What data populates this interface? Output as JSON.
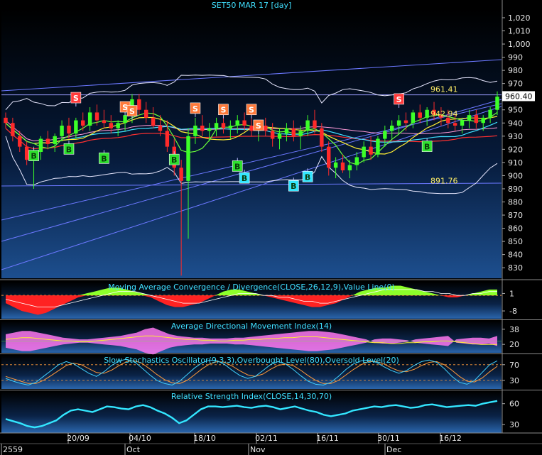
{
  "chart_data": {
    "type": "candlestick",
    "title": "SET50 MAR 17   [day]",
    "symbol": "SET50 MAR 17",
    "period": "[day]",
    "y_ticks": [
      "1,020",
      "1,010",
      "1,000",
      "990",
      "980",
      "970",
      "960",
      "950",
      "940",
      "930",
      "920",
      "910",
      "900",
      "890",
      "880",
      "870",
      "860",
      "850",
      "840",
      "830"
    ],
    "ylim": [
      822,
      1027
    ],
    "last_price": "960.40",
    "annotations": [
      {
        "label": "961.41",
        "value": 961.41
      },
      {
        "label": "942.94",
        "value": 942.94
      },
      {
        "label": "891.76",
        "value": 891.76
      }
    ],
    "x_tick_labels": [
      "20/09",
      "04/10",
      "18/10",
      "02/11",
      "16/11",
      "30/11",
      "16/12"
    ],
    "month_labels": [
      "2559",
      "Oct",
      "Nov",
      "Dec"
    ],
    "candles": [
      [
        944,
        948,
        936,
        940
      ],
      [
        940,
        944,
        926,
        930
      ],
      [
        930,
        934,
        918,
        922
      ],
      [
        922,
        926,
        908,
        912
      ],
      [
        912,
        922,
        890,
        918
      ],
      [
        918,
        930,
        912,
        928
      ],
      [
        928,
        934,
        920,
        924
      ],
      [
        924,
        932,
        918,
        930
      ],
      [
        930,
        942,
        926,
        938
      ],
      [
        938,
        944,
        928,
        932
      ],
      [
        932,
        944,
        928,
        942
      ],
      [
        942,
        948,
        934,
        938
      ],
      [
        938,
        952,
        934,
        948
      ],
      [
        948,
        954,
        938,
        942
      ],
      [
        942,
        950,
        936,
        940
      ],
      [
        940,
        946,
        932,
        936
      ],
      [
        936,
        942,
        930,
        940
      ],
      [
        940,
        948,
        934,
        946
      ],
      [
        946,
        962,
        940,
        958
      ],
      [
        958,
        962,
        946,
        950
      ],
      [
        950,
        956,
        940,
        944
      ],
      [
        944,
        952,
        936,
        938
      ],
      [
        938,
        946,
        930,
        934
      ],
      [
        934,
        942,
        918,
        922
      ],
      [
        922,
        928,
        900,
        906
      ],
      [
        906,
        912,
        824,
        896
      ],
      [
        896,
        936,
        852,
        930
      ],
      [
        930,
        944,
        924,
        938
      ],
      [
        938,
        946,
        930,
        934
      ],
      [
        934,
        940,
        926,
        936
      ],
      [
        936,
        944,
        930,
        940
      ],
      [
        940,
        946,
        932,
        936
      ],
      [
        936,
        942,
        928,
        938
      ],
      [
        938,
        946,
        932,
        942
      ],
      [
        942,
        948,
        934,
        938
      ],
      [
        938,
        944,
        930,
        934
      ],
      [
        934,
        940,
        926,
        938
      ],
      [
        938,
        944,
        930,
        934
      ],
      [
        934,
        940,
        922,
        928
      ],
      [
        928,
        936,
        920,
        932
      ],
      [
        932,
        940,
        926,
        936
      ],
      [
        936,
        942,
        926,
        930
      ],
      [
        930,
        938,
        920,
        934
      ],
      [
        934,
        946,
        930,
        942
      ],
      [
        942,
        950,
        932,
        936
      ],
      [
        936,
        940,
        918,
        922
      ],
      [
        922,
        926,
        900,
        906
      ],
      [
        906,
        914,
        898,
        910
      ],
      [
        910,
        916,
        902,
        904
      ],
      [
        904,
        912,
        898,
        908
      ],
      [
        908,
        918,
        904,
        914
      ],
      [
        914,
        926,
        910,
        922
      ],
      [
        922,
        930,
        912,
        916
      ],
      [
        916,
        930,
        914,
        928
      ],
      [
        928,
        938,
        922,
        934
      ],
      [
        934,
        942,
        928,
        938
      ],
      [
        938,
        946,
        932,
        942
      ],
      [
        942,
        948,
        934,
        940
      ],
      [
        940,
        950,
        936,
        948
      ],
      [
        948,
        954,
        940,
        944
      ],
      [
        944,
        952,
        938,
        950
      ],
      [
        950,
        956,
        942,
        946
      ],
      [
        946,
        952,
        938,
        944
      ],
      [
        944,
        950,
        936,
        940
      ],
      [
        940,
        946,
        934,
        938
      ],
      [
        938,
        944,
        932,
        942
      ],
      [
        942,
        950,
        936,
        946
      ],
      [
        946,
        950,
        936,
        940
      ],
      [
        940,
        946,
        934,
        944
      ],
      [
        944,
        952,
        940,
        950
      ],
      [
        950,
        964,
        946,
        960
      ]
    ],
    "signals": [
      {
        "label": "S",
        "idx": 10,
        "value": 959
      },
      {
        "label": "B",
        "idx": 4,
        "value": 915
      },
      {
        "label": "B",
        "idx": 9,
        "value": 920
      },
      {
        "label": "B",
        "idx": 14,
        "value": 913
      },
      {
        "label": "S",
        "idx": 17,
        "value": 952
      },
      {
        "label": "S",
        "idx": 18,
        "value": 949
      },
      {
        "label": "B",
        "idx": 24,
        "value": 912
      },
      {
        "label": "S",
        "idx": 27,
        "value": 951
      },
      {
        "label": "S",
        "idx": 31,
        "value": 950
      },
      {
        "label": "B",
        "idx": 33,
        "value": 907
      },
      {
        "label": "B",
        "idx": 34,
        "value": 898
      },
      {
        "label": "S",
        "idx": 35,
        "value": 950
      },
      {
        "label": "S",
        "idx": 36,
        "value": 938
      },
      {
        "label": "B",
        "idx": 41,
        "value": 892
      },
      {
        "label": "B",
        "idx": 43,
        "value": 899
      },
      {
        "label": "S",
        "idx": 56,
        "value": 958
      },
      {
        "label": "B",
        "idx": 60,
        "value": 922
      }
    ],
    "panels": [
      {
        "name": "macd",
        "title": "Moving Average Convergence / Divergence(CLOSE,26,12,9),Value Line(0)",
        "y_ticks": [
          "1",
          "-8"
        ],
        "tick_values": [
          1,
          -8
        ],
        "ylim": [
          -12,
          7
        ],
        "histogram": [
          -4,
          -6,
          -8,
          -9,
          -10,
          -9,
          -7,
          -5,
          -3,
          -1,
          1,
          2,
          3,
          4,
          4,
          3,
          2,
          1,
          -1,
          -3,
          -5,
          -6,
          -6,
          -5,
          -4,
          -2,
          0,
          2,
          3,
          3,
          2,
          1,
          0,
          -1,
          -2,
          -3,
          -4,
          -5,
          -6,
          -6,
          -5,
          -4,
          -2,
          0,
          2,
          3,
          4,
          4,
          5,
          5,
          4,
          3,
          2,
          1,
          0,
          -1,
          -1,
          0,
          1,
          2,
          3,
          3
        ],
        "signal_line": [
          -2,
          -3,
          -4,
          -5,
          -6,
          -6,
          -6,
          -5,
          -4,
          -3,
          -2,
          -1,
          0,
          1,
          2,
          2,
          2,
          1,
          0,
          -1,
          -2,
          -3,
          -4,
          -4,
          -4,
          -3,
          -2,
          -1,
          0,
          1,
          1,
          1,
          0,
          0,
          -1,
          -1,
          -2,
          -3,
          -3,
          -4,
          -4,
          -3,
          -2,
          -1,
          0,
          1,
          2,
          3,
          3,
          3,
          3,
          3,
          2,
          2,
          1,
          1,
          0,
          0,
          1,
          1,
          2,
          2
        ]
      },
      {
        "name": "adx",
        "title": "Average Directional Movement Index(14)",
        "y_ticks": [
          "38",
          "20"
        ],
        "tick_values": [
          38,
          20
        ],
        "ylim": [
          10,
          48
        ],
        "histogram": [
          8,
          10,
          12,
          12,
          10,
          8,
          6,
          4,
          3,
          2,
          2,
          3,
          4,
          5,
          6,
          8,
          10,
          14,
          16,
          12,
          8,
          6,
          5,
          4,
          4,
          3,
          3,
          3,
          4,
          4,
          5,
          6,
          7,
          8,
          9,
          10,
          11,
          12,
          12,
          11,
          10,
          8,
          6,
          4,
          2,
          -2,
          -3,
          -3,
          -2,
          -1,
          2,
          3,
          4,
          5,
          6,
          -2,
          -3,
          -4,
          -4,
          -3,
          -6
        ],
        "adx_line": [
          26,
          27,
          28,
          28,
          27,
          26,
          25,
          24,
          24,
          23,
          23,
          24,
          25,
          26,
          27,
          28,
          29,
          30,
          30,
          29,
          28,
          27,
          26,
          26,
          25,
          25,
          24,
          24,
          25,
          25,
          26,
          26,
          27,
          27,
          28,
          28,
          29,
          29,
          29,
          28,
          27,
          26,
          25,
          24,
          23,
          22,
          22,
          21,
          21,
          22,
          22,
          23,
          23,
          24,
          24,
          23,
          22,
          21,
          20,
          20,
          20
        ]
      },
      {
        "name": "stochastic",
        "title": "Slow Stochastics Oscillator(9,3,3),Overbought Level(80),Oversold Level(20)",
        "y_ticks": [
          "70",
          "30"
        ],
        "tick_values": [
          70,
          30
        ],
        "ylim": [
          8,
          95
        ],
        "k_line": [
          35,
          28,
          22,
          18,
          25,
          40,
          55,
          70,
          78,
          72,
          60,
          48,
          40,
          52,
          68,
          80,
          84,
          78,
          62,
          45,
          30,
          22,
          18,
          28,
          45,
          62,
          75,
          82,
          80,
          70,
          55,
          42,
          35,
          40,
          55,
          70,
          78,
          72,
          58,
          42,
          28,
          20,
          18,
          25,
          40,
          58,
          72,
          80,
          82,
          76,
          65,
          55,
          48,
          55,
          68,
          78,
          82,
          76,
          60,
          40,
          25,
          20,
          30,
          50,
          70,
          80
        ],
        "d_line": [
          40,
          34,
          28,
          22,
          22,
          30,
          42,
          55,
          68,
          74,
          70,
          60,
          50,
          48,
          56,
          68,
          78,
          80,
          74,
          60,
          45,
          32,
          24,
          22,
          30,
          45,
          60,
          72,
          78,
          76,
          66,
          54,
          44,
          40,
          46,
          58,
          68,
          72,
          68,
          56,
          42,
          30,
          22,
          22,
          30,
          44,
          58,
          70,
          78,
          78,
          72,
          62,
          54,
          52,
          58,
          68,
          76,
          78,
          70,
          56,
          40,
          28,
          26,
          36,
          52,
          66
        ]
      },
      {
        "name": "rsi",
        "title": "Relative Strength Index(CLOSE,14,30,70)",
        "y_ticks": [
          "60",
          "30"
        ],
        "tick_values": [
          60,
          30
        ],
        "ylim": [
          18,
          78
        ],
        "rsi_line": [
          38,
          35,
          32,
          28,
          26,
          28,
          32,
          36,
          44,
          50,
          52,
          50,
          48,
          52,
          56,
          55,
          53,
          52,
          56,
          58,
          55,
          50,
          46,
          40,
          32,
          36,
          44,
          52,
          56,
          56,
          55,
          56,
          57,
          55,
          54,
          56,
          57,
          55,
          52,
          54,
          56,
          53,
          50,
          48,
          44,
          42,
          44,
          46,
          50,
          52,
          54,
          56,
          55,
          57,
          58,
          56,
          54,
          55,
          58,
          59,
          57,
          55,
          56,
          57,
          58,
          57,
          60,
          62,
          64
        ]
      }
    ]
  }
}
